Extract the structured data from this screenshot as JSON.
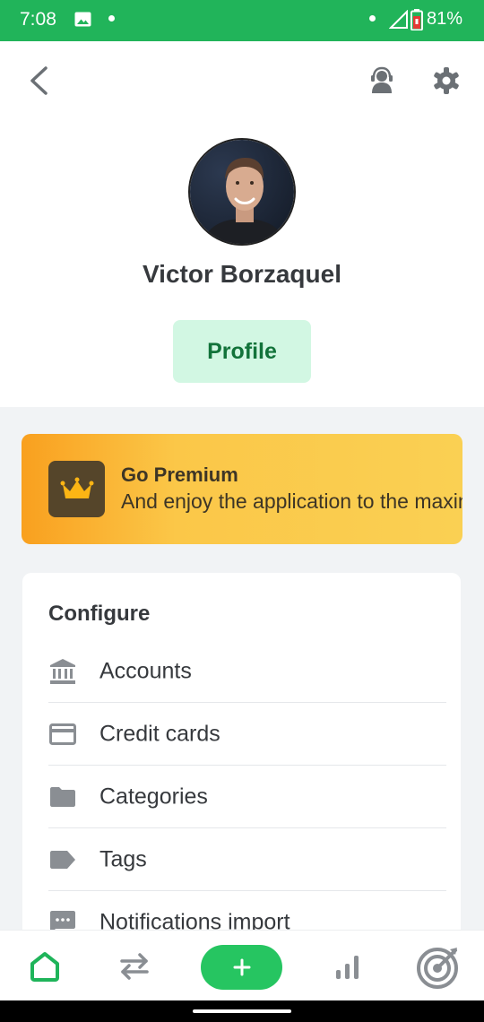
{
  "status_bar": {
    "time": "7:08",
    "battery": "81%",
    "icons": [
      "image-icon",
      "notification-dot",
      "signal-icon",
      "battery-icon"
    ],
    "background_color": "#21b45a"
  },
  "header": {
    "icons": [
      "back-arrow-icon",
      "support-icon",
      "gear-icon"
    ],
    "user_name": "Victor Borzaquel",
    "profile_button": "Profile"
  },
  "premium_banner": {
    "title": "Go Premium",
    "subtitle": "And enjoy the application to the maximum",
    "icon": "crown-icon",
    "colors": [
      "#f9a01f",
      "#fad053"
    ]
  },
  "configure": {
    "title": "Configure",
    "items": [
      {
        "label": "Accounts",
        "icon": "bank-icon"
      },
      {
        "label": "Credit cards",
        "icon": "credit-card-icon"
      },
      {
        "label": "Categories",
        "icon": "folder-icon"
      },
      {
        "label": "Tags",
        "icon": "tag-icon"
      },
      {
        "label": "Notifications import",
        "icon": "message-icon"
      }
    ]
  },
  "tab_bar": {
    "tabs": [
      "home-icon",
      "transfer-icon",
      "add-icon",
      "stats-icon",
      "goal-icon"
    ],
    "active_tab": "home",
    "accent_color": "#26c561"
  }
}
